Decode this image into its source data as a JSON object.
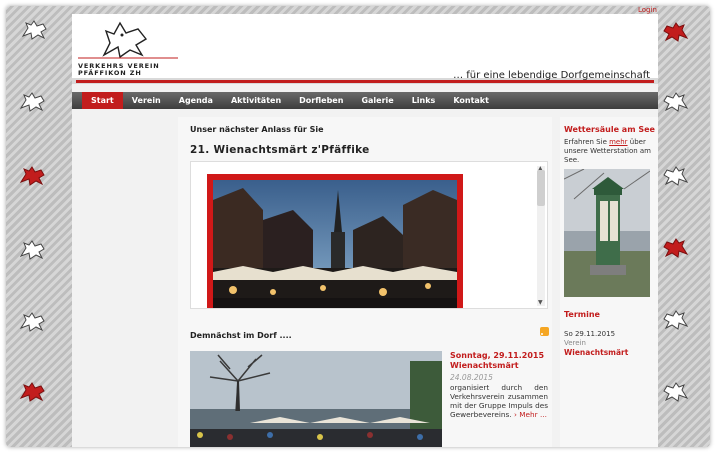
{
  "login_label": "Login",
  "brand": {
    "name_line1": "VERKEHRS  VEREIN",
    "name_line2": "PFÄFFIKON ZH",
    "tagline": "… für eine lebendige Dorfgemeinschaft",
    "accent_color": "#c21d1d"
  },
  "nav": {
    "items": [
      {
        "label": "Start",
        "active": true
      },
      {
        "label": "Verein"
      },
      {
        "label": "Agenda"
      },
      {
        "label": "Aktivitäten"
      },
      {
        "label": "Dorfleben"
      },
      {
        "label": "Galerie"
      },
      {
        "label": "Links"
      },
      {
        "label": "Kontakt"
      }
    ]
  },
  "main": {
    "next_event_heading": "Unser nächster Anlass für Sie",
    "next_event_title": "21. Wienachtsmärt z'Pfäffike",
    "news_heading": "Demnächst im Dorf ....",
    "news": {
      "date": "Sonntag, 29.11.2015",
      "title": "Wienachtsmärt",
      "published": "24.08.2015",
      "text": "organisiert durch den Verkehrsverein zusammen mit der Gruppe Impuls des Gewerbevereins.",
      "more_label": "Mehr ..."
    }
  },
  "sidebar": {
    "weather_title": "Wettersäule am See",
    "weather_text_before": "Erfahren Sie ",
    "weather_link": "mehr",
    "weather_text_after": " über unsere Wetterstation am See.",
    "termine_title": "Termine",
    "termin_date": "So 29.11.2015",
    "termin_category": "Verein",
    "termin_name": "Wienachtsmärt"
  },
  "icons": [
    "lion-icon",
    "rss-icon",
    "chevron-right-icon",
    "scroll-up-icon",
    "scroll-down-icon"
  ]
}
